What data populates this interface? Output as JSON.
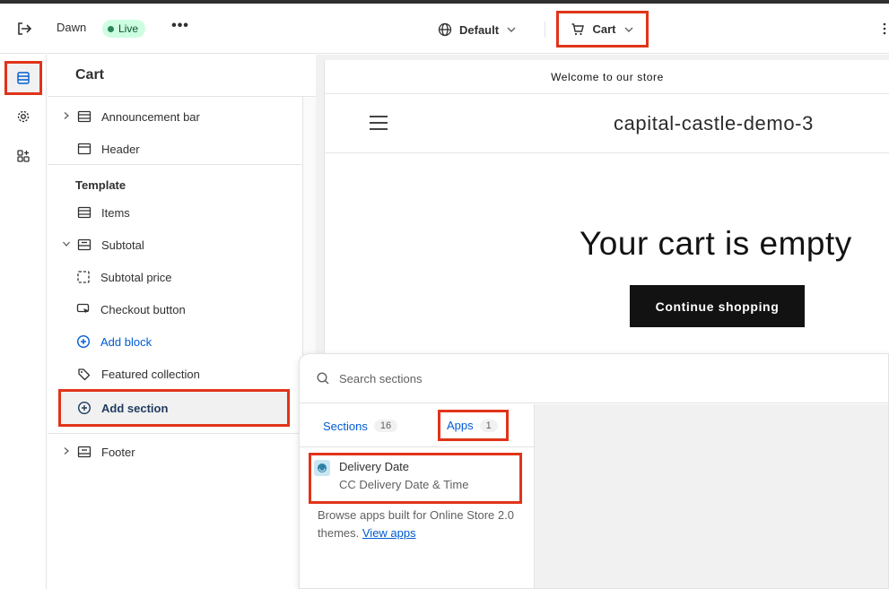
{
  "topbar": {
    "theme_name": "Dawn",
    "status_badge": "Live",
    "more_label": "•••",
    "language_label": "Default",
    "template_label": "Cart"
  },
  "panel": {
    "title": "Cart",
    "items": {
      "announcement": "Announcement bar",
      "header": "Header",
      "template_heading": "Template",
      "items": "Items",
      "subtotal": "Subtotal",
      "subtotal_price": "Subtotal price",
      "checkout_button": "Checkout button",
      "add_block": "Add block",
      "featured_collection": "Featured collection",
      "add_section": "Add section",
      "footer": "Footer"
    }
  },
  "preview": {
    "announcement": "Welcome to our store",
    "store_name": "capital-castle-demo-3",
    "empty_title": "Your cart is empty",
    "continue_button": "Continue shopping"
  },
  "picker": {
    "search_placeholder": "Search sections",
    "tabs": {
      "sections_label": "Sections",
      "sections_count": "16",
      "apps_label": "Apps",
      "apps_count": "1"
    },
    "app": {
      "name": "Delivery Date",
      "subtitle": "CC Delivery Date & Time"
    },
    "browse_text": "Browse apps built for Online Store 2.0 themes.",
    "browse_link": "View apps"
  },
  "colors": {
    "highlight": "#e0341a",
    "link": "#005bd3",
    "live_badge_bg": "#cdfee1",
    "button_dark": "#121212"
  }
}
